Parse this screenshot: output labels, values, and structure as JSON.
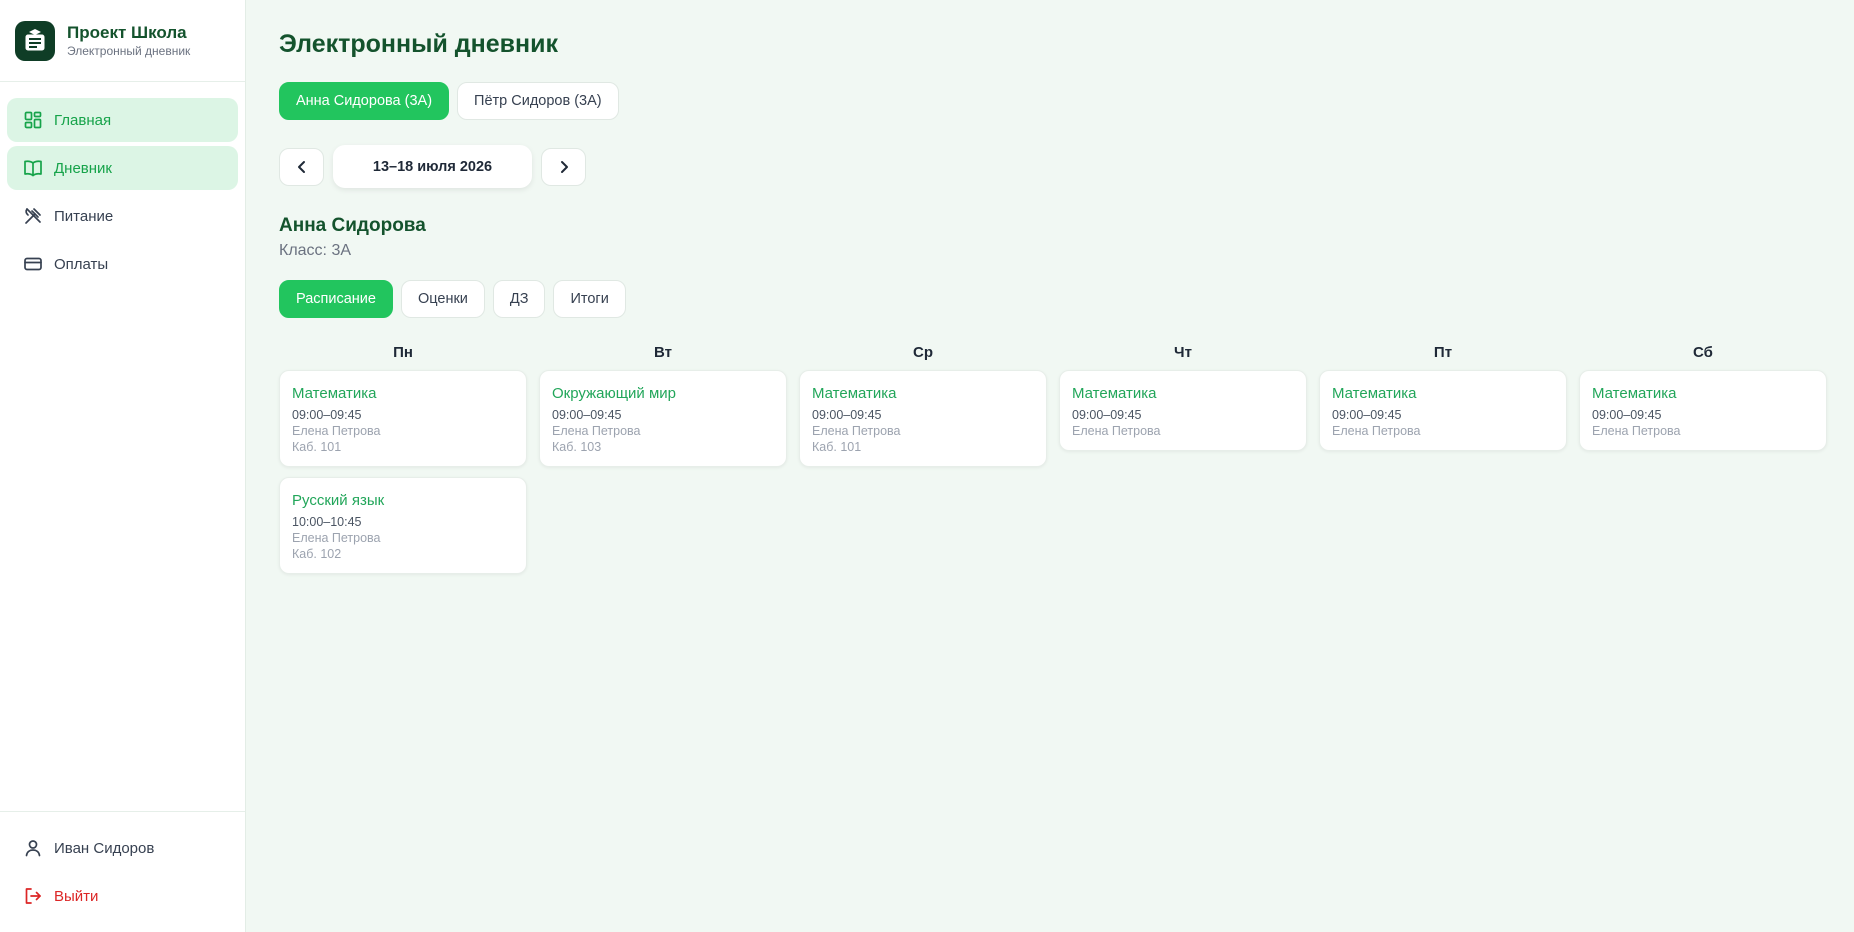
{
  "brand": {
    "title": "Проект Школа",
    "subtitle": "Электронный дневник"
  },
  "sidebar": {
    "items": [
      {
        "label": "Главная",
        "icon": "dashboard-icon"
      },
      {
        "label": "Дневник",
        "icon": "book-icon"
      },
      {
        "label": "Питание",
        "icon": "utensils-icon"
      },
      {
        "label": "Оплаты",
        "icon": "credit-card-icon"
      }
    ],
    "user": {
      "label": "Иван Сидоров",
      "icon": "user-icon"
    },
    "logout": {
      "label": "Выйти",
      "icon": "logout-icon"
    }
  },
  "page": {
    "title": "Электронный дневник"
  },
  "children": [
    {
      "label": "Анна Сидорова (3А)",
      "active": true
    },
    {
      "label": "Пётр Сидоров (3А)",
      "active": false
    }
  ],
  "week": {
    "label": "13–18 июля 2026"
  },
  "student": {
    "name": "Анна Сидорова",
    "class": "Класс: 3А"
  },
  "sections": [
    {
      "label": "Расписание",
      "active": true
    },
    {
      "label": "Оценки",
      "active": false
    },
    {
      "label": "ДЗ",
      "active": false
    },
    {
      "label": "Итоги",
      "active": false
    }
  ],
  "schedule": [
    {
      "day": "Пн",
      "lessons": [
        {
          "subject": "Математика",
          "time": "09:00–09:45",
          "teacher": "Елена Петрова",
          "room": "Каб. 101"
        },
        {
          "subject": "Русский язык",
          "time": "10:00–10:45",
          "teacher": "Елена Петрова",
          "room": "Каб. 102"
        }
      ]
    },
    {
      "day": "Вт",
      "lessons": [
        {
          "subject": "Окружающий мир",
          "time": "09:00–09:45",
          "teacher": "Елена Петрова",
          "room": "Каб. 103"
        }
      ]
    },
    {
      "day": "Ср",
      "lessons": [
        {
          "subject": "Математика",
          "time": "09:00–09:45",
          "teacher": "Елена Петрова",
          "room": "Каб. 101"
        }
      ]
    },
    {
      "day": "Чт",
      "lessons": [
        {
          "subject": "Математика",
          "time": "09:00–09:45",
          "teacher": "Елена Петрова",
          "room": ""
        }
      ]
    },
    {
      "day": "Пт",
      "lessons": [
        {
          "subject": "Математика",
          "time": "09:00–09:45",
          "teacher": "Елена Петрова",
          "room": ""
        }
      ]
    },
    {
      "day": "Сб",
      "lessons": [
        {
          "subject": "Математика",
          "time": "09:00–09:45",
          "teacher": "Елена Петрова",
          "room": ""
        }
      ]
    }
  ],
  "colors": {
    "accent": "#22c55e",
    "accent_text": "#16a34a",
    "title": "#14532d",
    "background": "#f1f8f3",
    "danger": "#dc2626"
  }
}
